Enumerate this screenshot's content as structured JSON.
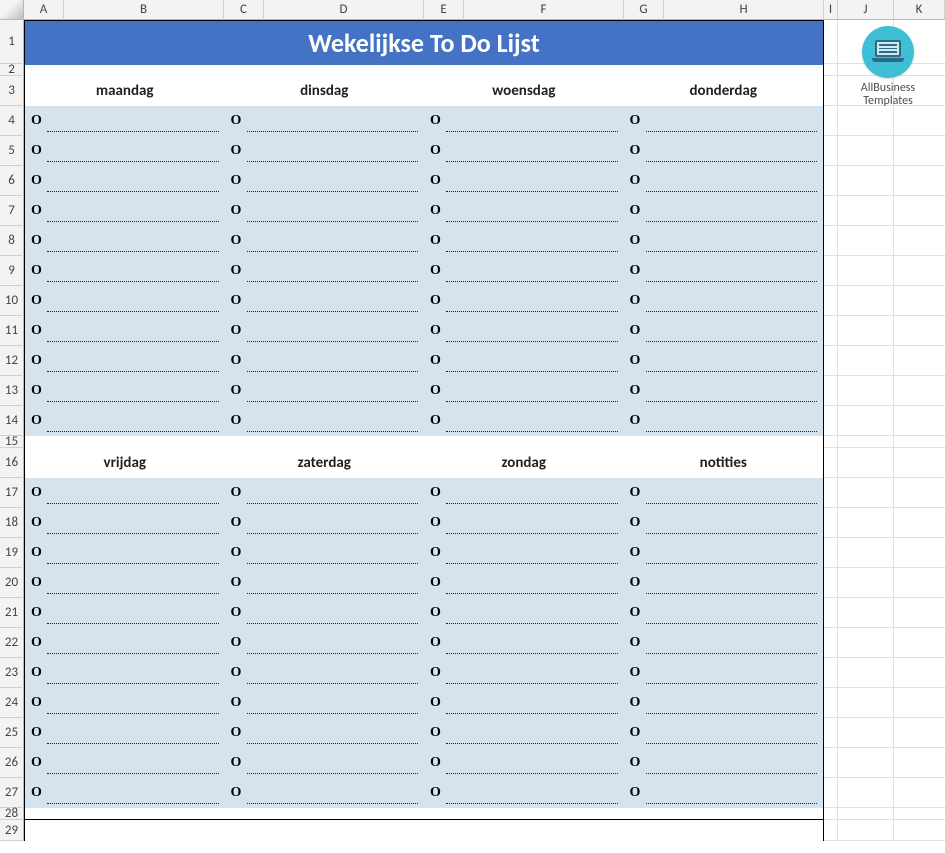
{
  "columns": [
    "A",
    "B",
    "C",
    "D",
    "E",
    "F",
    "G",
    "H",
    "I",
    "J",
    "K"
  ],
  "rowCount": 29,
  "title": "Wekelijkse To Do Lijst",
  "section1": {
    "headers": [
      "maandag",
      "dinsdag",
      "woensdag",
      "donderdag"
    ]
  },
  "section2": {
    "headers": [
      "vrijdag",
      "zaterdag",
      "zondag",
      "notities"
    ]
  },
  "bullet": "O",
  "tasksPerDay": 11,
  "logo": {
    "line1": "AllBusiness",
    "line2": "Templates"
  }
}
